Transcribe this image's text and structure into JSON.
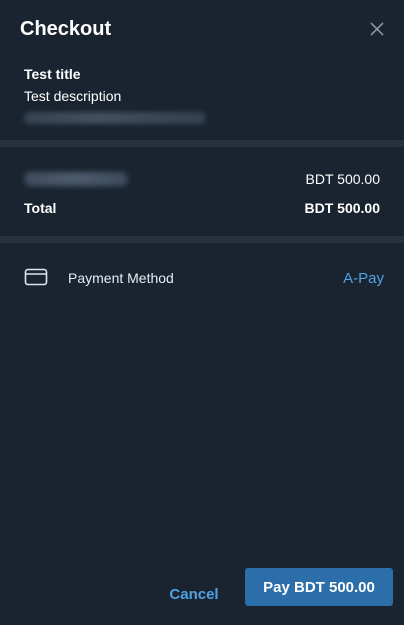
{
  "header": {
    "title": "Checkout",
    "close_icon": "close-icon"
  },
  "item": {
    "title": "Test title",
    "description": "Test description"
  },
  "summary": {
    "line_value": "BDT 500.00",
    "total_label": "Total",
    "total_value": "BDT 500.00"
  },
  "payment": {
    "icon": "credit-card-icon",
    "label": "Payment Method",
    "value": "A-Pay"
  },
  "footer": {
    "cancel_label": "Cancel",
    "pay_label": "Pay BDT 500.00"
  },
  "colors": {
    "background": "#1a2430",
    "divider": "#27323f",
    "accent": "#4fa3e4",
    "primary_button": "#2c6eaa"
  }
}
